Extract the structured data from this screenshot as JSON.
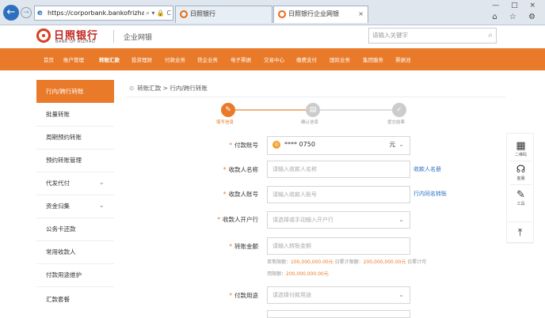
{
  "browser": {
    "back_glyph": "←",
    "forward_glyph": "→",
    "url": "https://corporbank.bankofrizhao...",
    "addr_icons": "⌕ ▾ 🔒 C",
    "tabs": [
      {
        "label": "日照银行"
      },
      {
        "label": "日照银行企业网银"
      }
    ],
    "tab_close": "×",
    "window_controls": "— □ ×",
    "window_controls2": "⌂ ☆ ⚙"
  },
  "header": {
    "bank_name": "日照银行",
    "bank_name_en": "BANK OF RIZHAO",
    "site_section": "企业网银",
    "search_placeholder": "请输入关键字",
    "search_icon": "⌕"
  },
  "topnav": {
    "items": [
      "首页",
      "账户管理",
      "转账汇款",
      "投资理财",
      "付款业务",
      "贷企业务",
      "电子票据",
      "交易中心",
      "缴费支付",
      "国际业务",
      "集团服务",
      "票据池"
    ],
    "active_index": 2
  },
  "sidebar": {
    "items": [
      {
        "label": "行内/跨行转账",
        "active": true,
        "chev": ""
      },
      {
        "label": "批量转账",
        "chev": ""
      },
      {
        "label": "周期预约转账",
        "chev": ""
      },
      {
        "label": "预约转账管理",
        "chev": ""
      },
      {
        "label": "代发代付",
        "chev": "⌄"
      },
      {
        "label": "资金归集",
        "chev": "⌄"
      },
      {
        "label": "公务卡还款",
        "chev": ""
      },
      {
        "label": "常用收款人",
        "chev": ""
      },
      {
        "label": "付款用途维护",
        "chev": ""
      },
      {
        "label": "汇款套餐",
        "chev": ""
      }
    ]
  },
  "breadcrumb": {
    "pin": "⊙",
    "text": "转账汇款 > 行内/跨行转账"
  },
  "steps": [
    {
      "label": "填写信息",
      "glyph": "✎",
      "active": true
    },
    {
      "label": "确认信息",
      "glyph": "▤"
    },
    {
      "label": "提交结果",
      "glyph": "✓"
    }
  ],
  "form": {
    "required_mark": "*",
    "payer_account": {
      "label": "付款账号",
      "icon_glyph": "◎",
      "value": "**** 0750",
      "currency": "元",
      "caret": "⌄"
    },
    "payee_name": {
      "label": "收款人名称",
      "placeholder": "请输入收款人名称",
      "link": "收款人名册"
    },
    "payee_account": {
      "label": "收款人账号",
      "placeholder": "请输入收款人账号",
      "link": "行内同名转账"
    },
    "payee_bank": {
      "label": "收款人开户行",
      "placeholder": "请选择或手动输入开户行",
      "caret": "⌄"
    },
    "amount": {
      "label": "转账金额",
      "placeholder": "请输入转账金额"
    },
    "limits_line1": {
      "prefix": "单笔限额：",
      "single": "100,000,000.00元",
      "mid": " 日累计限额：",
      "daily": "200,000,000.00元",
      "suffix": " 日累计可"
    },
    "limits_line2": {
      "prefix": "用限额：",
      "available": "200,000,000.00元"
    },
    "purpose": {
      "label": "付款用途",
      "placeholder": "请选择付款用途",
      "caret": "⌄"
    }
  },
  "tools": [
    {
      "label": "二维码",
      "icon": "qr-icon",
      "glyph": "▦"
    },
    {
      "label": "客服",
      "icon": "headset-icon",
      "glyph": "☊"
    },
    {
      "label": "工具",
      "icon": "wrench-icon",
      "glyph": "✎"
    }
  ],
  "scroll_top_glyph": "⤒"
}
